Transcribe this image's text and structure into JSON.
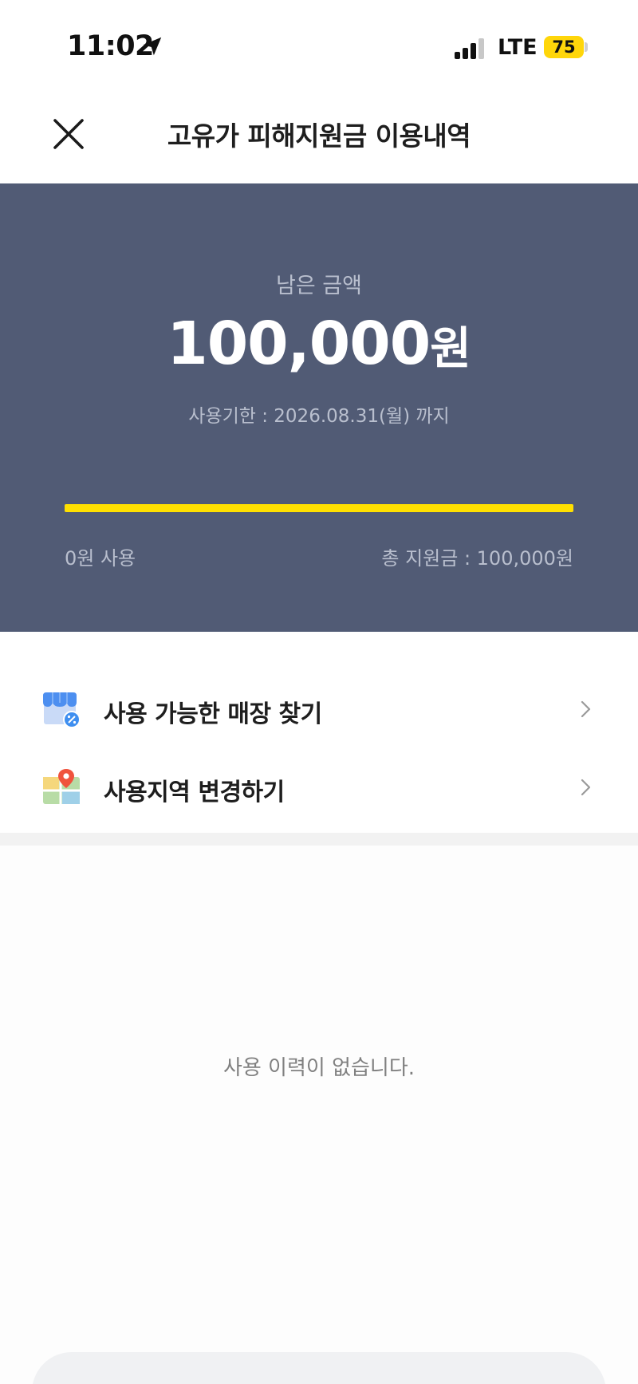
{
  "status_bar": {
    "time": "11:02",
    "network": "LTE",
    "battery": "75",
    "icons": [
      "location-arrow-icon",
      "signal-icon",
      "battery-icon"
    ]
  },
  "header": {
    "title": "고유가 피해지원금 이용내역",
    "close_icon": "close-icon"
  },
  "summary": {
    "remaining_label": "남은 금액",
    "remaining_amount": "100,000",
    "remaining_unit": "원",
    "expiry": "사용기한 : 2026.08.31(월) 까지",
    "used_label": "0원 사용",
    "total_label": "총 지원금 : 100,000원",
    "remaining_fraction": 1.0,
    "bar_color": "#ffe000",
    "panel_color": "#515b75"
  },
  "menu": {
    "items": [
      {
        "label": "사용 가능한 매장 찾기",
        "icon": "store-discount-icon"
      },
      {
        "label": "사용지역 변경하기",
        "icon": "map-pin-icon"
      }
    ]
  },
  "history": {
    "empty_text": "사용 이력이 없습니다."
  }
}
